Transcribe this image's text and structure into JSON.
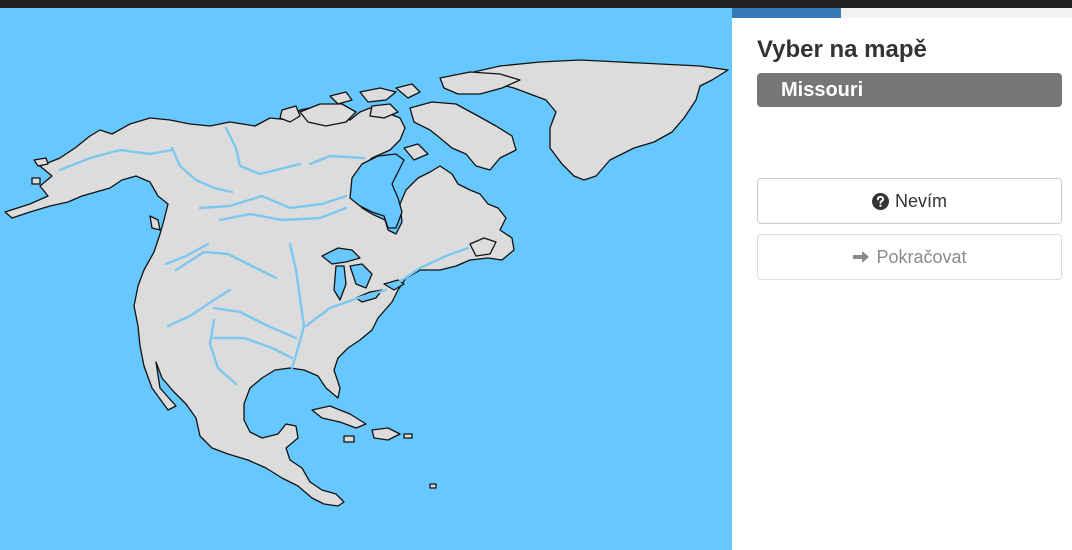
{
  "quiz": {
    "prompt": "Vyber na mapě",
    "target": "Missouri",
    "target_color": "#777777",
    "progress_fraction": 0.32,
    "progress_color": "#337ab7"
  },
  "buttons": {
    "unknown": {
      "label": "Nevím",
      "icon": "question-circle-icon"
    },
    "continue": {
      "label": "Pokračovat",
      "icon": "arrow-right-icon",
      "disabled": true
    }
  },
  "map": {
    "region": "North America",
    "water_color": "#66c8ff",
    "land_color": "#dcdcdc",
    "river_color": "#7ec8f0"
  }
}
